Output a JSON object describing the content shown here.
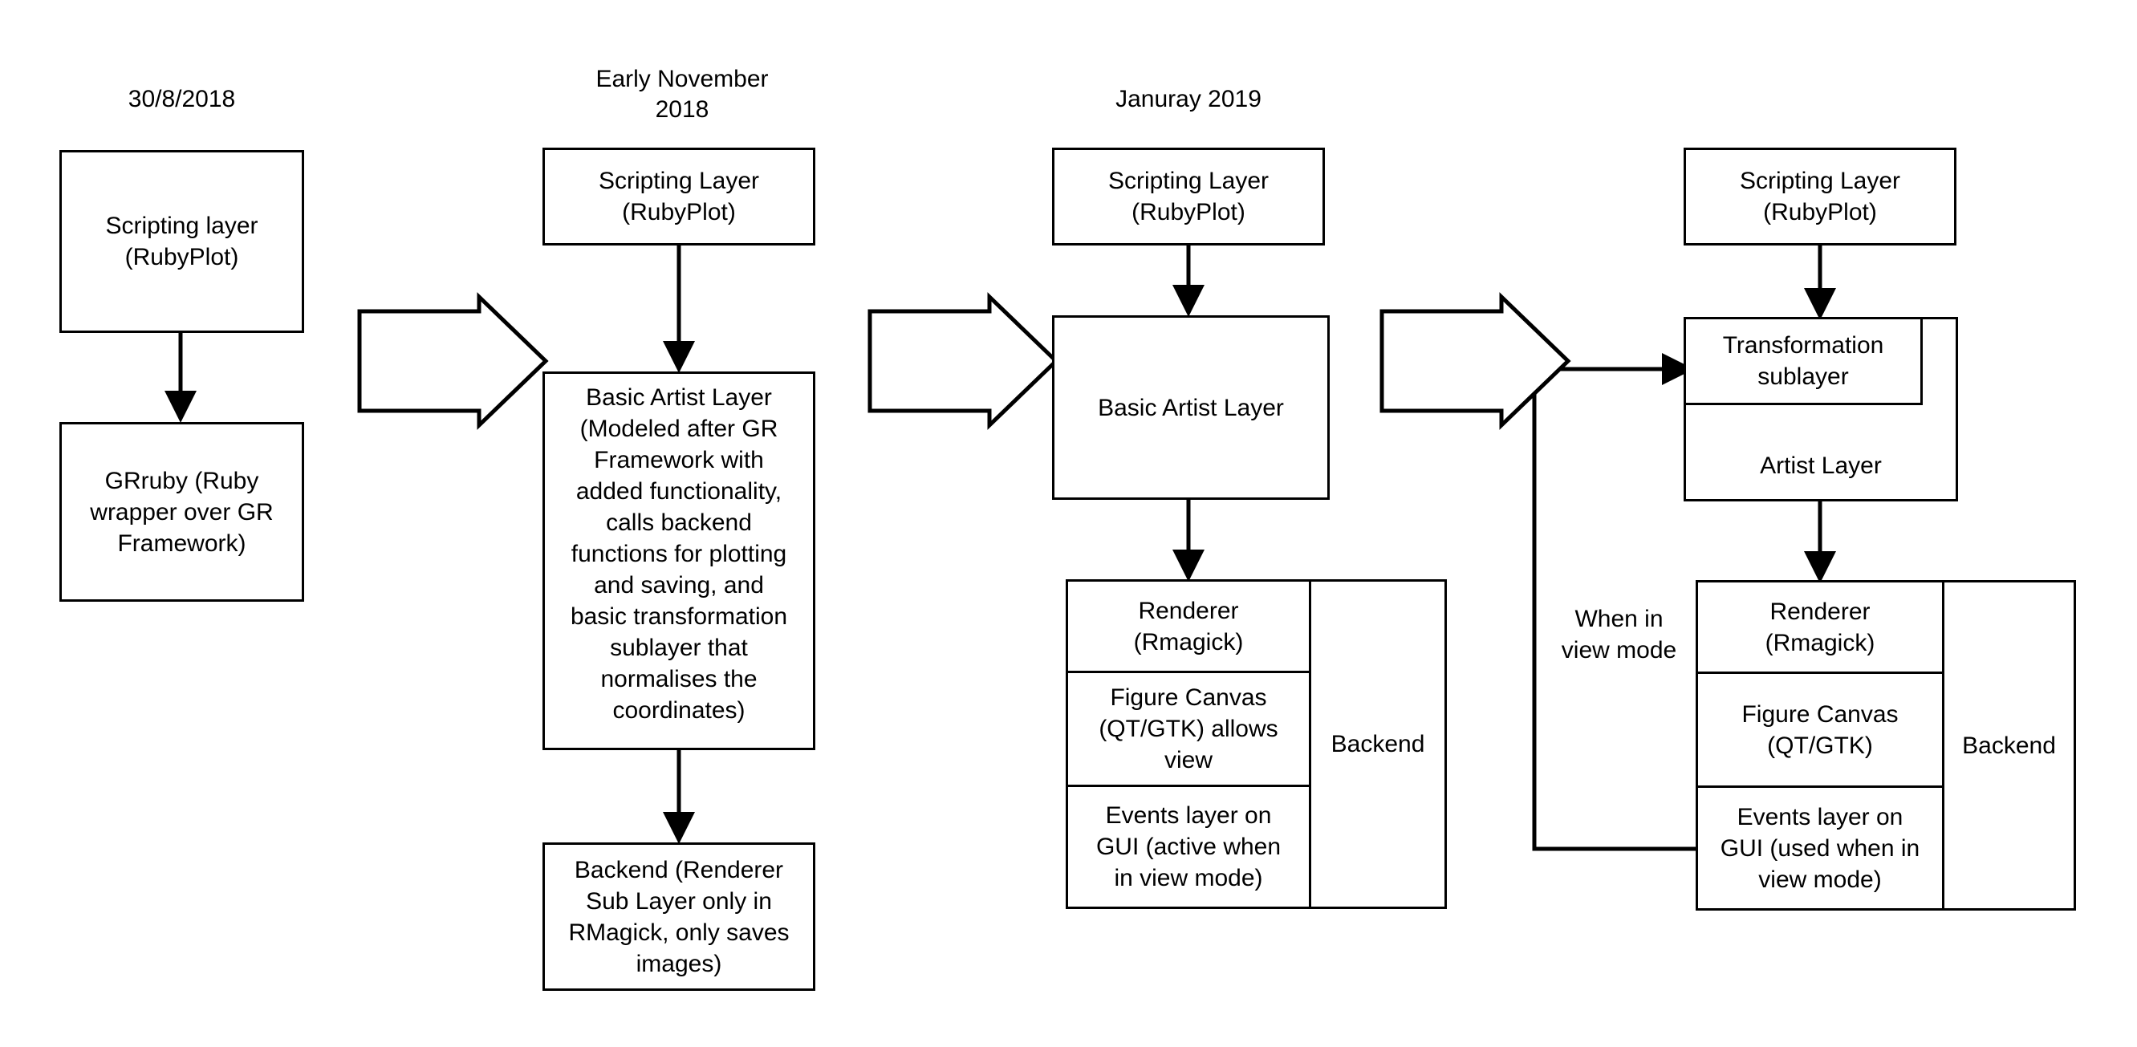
{
  "diagram": {
    "title_hidden": "RubyPlot architecture evolution timeline",
    "background": "#ffffff",
    "stroke": "#000000",
    "columns": [
      {
        "id": "col-2018-08-30",
        "heading": "30/8/2018",
        "nodes": [
          {
            "id": "c1-scripting-layer",
            "label": "Scripting layer\n(RubyPlot)"
          },
          {
            "id": "c1-grruby",
            "label": "GRruby  (Ruby\nwrapper over GR\nFramework)"
          }
        ]
      },
      {
        "id": "col-early-nov-2018",
        "heading": "Early November\n2018",
        "nodes": [
          {
            "id": "c2-scripting-layer",
            "label": "Scripting Layer\n(RubyPlot)"
          },
          {
            "id": "c2-basic-artist-layer",
            "label": "Basic Artist Layer\n(Modeled after GR\nFramework with\nadded functionality,\ncalls backend\nfunctions for plotting\nand saving, and\nbasic transformation\nsublayer that\nnormalises the\ncoordinates)"
          },
          {
            "id": "c2-backend",
            "label": "Backend (Renderer\nSub Layer only in\nRMagick, only saves\nimages)"
          }
        ]
      },
      {
        "id": "col-january-2019",
        "heading": "Januray 2019",
        "nodes": [
          {
            "id": "c3-scripting-layer",
            "label": "Scripting Layer\n(RubyPlot)"
          },
          {
            "id": "c3-basic-artist-layer",
            "label": "Basic Artist Layer"
          },
          {
            "id": "c3-renderer",
            "label": "Renderer\n(Rmagick)"
          },
          {
            "id": "c3-figure-canvas",
            "label": "Figure Canvas\n(QT/GTK) allows\nview"
          },
          {
            "id": "c3-events-layer",
            "label": "Events layer on\nGUI (active when\nin view mode)"
          },
          {
            "id": "c3-backend",
            "label": "Backend"
          }
        ]
      },
      {
        "id": "col-latest",
        "heading": "",
        "nodes": [
          {
            "id": "c4-scripting-layer",
            "label": "Scripting Layer\n(RubyPlot)"
          },
          {
            "id": "c4-artist-layer",
            "label": "Artist Layer"
          },
          {
            "id": "c4-transformation-sublayer",
            "label": "Transformation\nsublayer"
          },
          {
            "id": "c4-renderer",
            "label": "Renderer\n(Rmagick)"
          },
          {
            "id": "c4-figure-canvas",
            "label": "Figure Canvas\n(QT/GTK)"
          },
          {
            "id": "c4-events-layer",
            "label": "Events layer on\nGUI (used when in\nview mode)"
          },
          {
            "id": "c4-backend",
            "label": "Backend"
          }
        ]
      }
    ],
    "annotations": [
      {
        "id": "view-mode-note",
        "label": "When in\nview mode"
      }
    ],
    "block_arrows": [
      {
        "id": "stage-arrow-1"
      },
      {
        "id": "stage-arrow-2"
      },
      {
        "id": "stage-arrow-3"
      }
    ]
  }
}
